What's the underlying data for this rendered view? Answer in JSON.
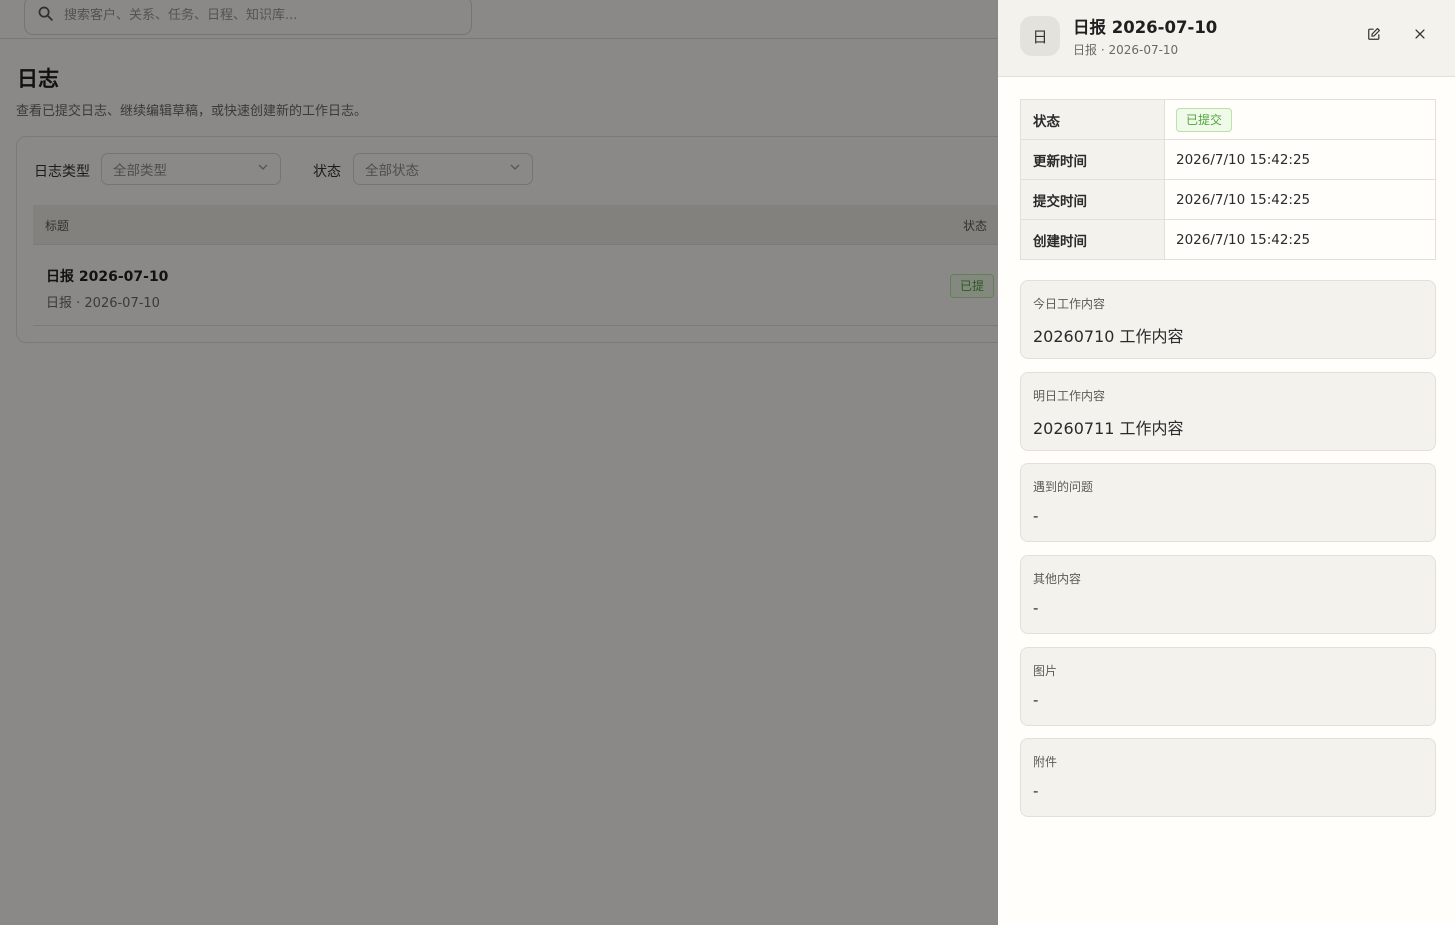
{
  "search": {
    "placeholder": "搜索客户、关系、任务、日程、知识库..."
  },
  "page": {
    "title": "日志",
    "description": "查看已提交日志、继续编辑草稿，或快速创建新的工作日志。"
  },
  "filters": {
    "type_label": "日志类型",
    "type_value": "全部类型",
    "status_label": "状态",
    "status_value": "全部状态"
  },
  "table": {
    "columns": [
      "标题",
      "状态"
    ],
    "rows": [
      {
        "title": "日报 2026-07-10",
        "subtitle": "日报 · 2026-07-10",
        "status": "已提"
      }
    ]
  },
  "drawer": {
    "avatar": "日",
    "title": "日报 2026-07-10",
    "subtitle": "日报 · 2026-07-10",
    "info": [
      {
        "key": "状态",
        "value": "已提交"
      },
      {
        "key": "更新时间",
        "value": "2026/7/10 15:42:25"
      },
      {
        "key": "提交时间",
        "value": "2026/7/10 15:42:25"
      },
      {
        "key": "创建时间",
        "value": "2026/7/10 15:42:25"
      }
    ],
    "sections": [
      {
        "label": "今日工作内容",
        "value": "20260710 工作内容"
      },
      {
        "label": "明日工作内容",
        "value": "20260711 工作内容"
      },
      {
        "label": "遇到的问题",
        "value": "-"
      },
      {
        "label": "其他内容",
        "value": "-"
      },
      {
        "label": "图片",
        "value": "-"
      },
      {
        "label": "附件",
        "value": "-"
      }
    ]
  },
  "icons": {
    "search": "search-icon",
    "chevron": "chevron-down-icon",
    "edit": "edit-icon",
    "close": "close-icon"
  },
  "colors": {
    "success": "#52a43a",
    "success_bg": "#f0faea",
    "overlay": "rgba(0,0,0,0.45)"
  }
}
